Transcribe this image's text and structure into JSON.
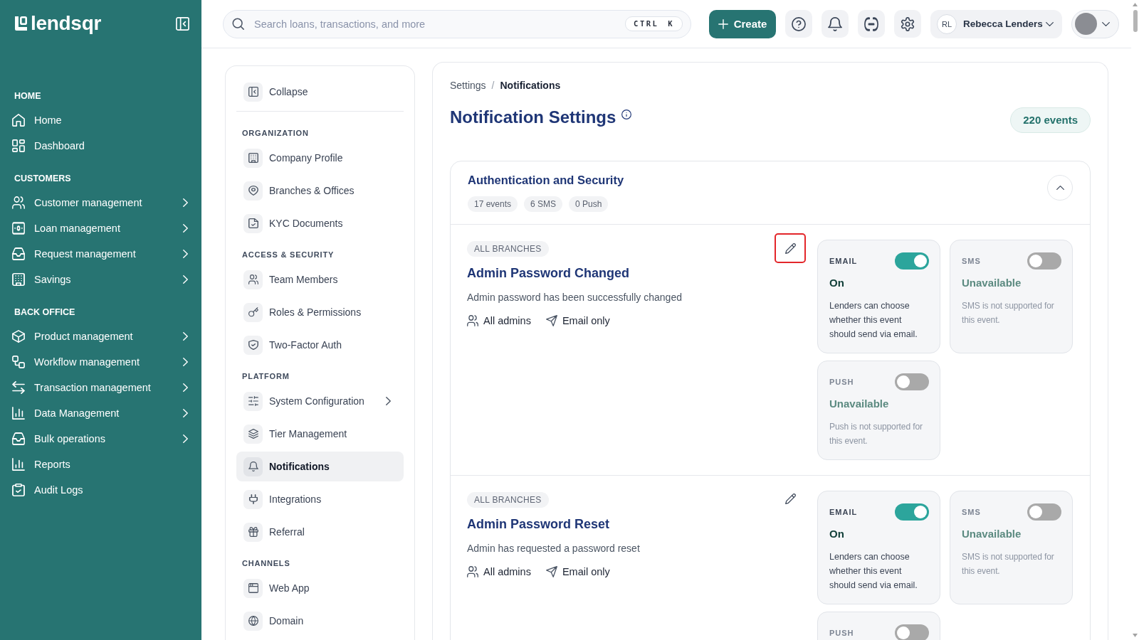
{
  "sidebar": {
    "logo": "lendsqr",
    "sections": [
      {
        "title": "HOME",
        "items": [
          {
            "label": "Home",
            "expandable": false,
            "selected": false
          },
          {
            "label": "Dashboard",
            "expandable": false,
            "selected": false
          }
        ]
      },
      {
        "title": "CUSTOMERS",
        "items": [
          {
            "label": "Customer management",
            "expandable": true,
            "selected": false
          },
          {
            "label": "Loan management",
            "expandable": true,
            "selected": false
          },
          {
            "label": "Request management",
            "expandable": true,
            "selected": false
          },
          {
            "label": "Savings",
            "expandable": true,
            "selected": false
          }
        ]
      },
      {
        "title": "BACK OFFICE",
        "items": [
          {
            "label": "Product management",
            "expandable": true,
            "selected": false
          },
          {
            "label": "Workflow management",
            "expandable": true,
            "selected": false
          },
          {
            "label": "Transaction management",
            "expandable": true,
            "selected": false
          },
          {
            "label": "Data Management",
            "expandable": true,
            "selected": false
          },
          {
            "label": "Bulk operations",
            "expandable": true,
            "selected": false
          },
          {
            "label": "Reports",
            "expandable": false,
            "selected": false
          },
          {
            "label": "Audit Logs",
            "expandable": false,
            "selected": false
          }
        ]
      }
    ]
  },
  "topbar": {
    "search": {
      "placeholder": "Search loans, transactions, and more",
      "shortcut": "CTRL K"
    },
    "create_button": "Create",
    "user": {
      "initials": "RL",
      "name": "Rebecca Lenders"
    }
  },
  "settings_nav": {
    "collapse": "Collapse",
    "sections": [
      {
        "title": "ORGANIZATION",
        "items": [
          {
            "label": "Company Profile",
            "expandable": false,
            "selected": false
          },
          {
            "label": "Branches & Offices",
            "expandable": false,
            "selected": false
          },
          {
            "label": "KYC Documents",
            "expandable": false,
            "selected": false
          }
        ]
      },
      {
        "title": "ACCESS & SECURITY",
        "items": [
          {
            "label": "Team Members",
            "expandable": false,
            "selected": false
          },
          {
            "label": "Roles & Permissions",
            "expandable": false,
            "selected": false
          },
          {
            "label": "Two-Factor Auth",
            "expandable": false,
            "selected": false
          }
        ]
      },
      {
        "title": "PLATFORM",
        "items": [
          {
            "label": "System Configuration",
            "expandable": true,
            "selected": false
          },
          {
            "label": "Tier Management",
            "expandable": false,
            "selected": false
          },
          {
            "label": "Notifications",
            "expandable": false,
            "selected": true
          },
          {
            "label": "Integrations",
            "expandable": false,
            "selected": false
          },
          {
            "label": "Referral",
            "expandable": false,
            "selected": false
          }
        ]
      },
      {
        "title": "CHANNELS",
        "items": [
          {
            "label": "Web App",
            "expandable": false,
            "selected": false
          },
          {
            "label": "Domain",
            "expandable": false,
            "selected": false
          }
        ]
      }
    ]
  },
  "page": {
    "breadcrumb": {
      "separator": "/",
      "items": [
        {
          "label": "Settings",
          "current": false
        },
        {
          "label": "Notifications",
          "current": true
        }
      ]
    },
    "title": "Notification Settings",
    "event_count": "220 events"
  },
  "groups": [
    {
      "title": "Authentication and Security",
      "counts": [
        "17 events",
        "6 SMS",
        "0 Push"
      ],
      "expanded": true,
      "events": [
        {
          "scope": "ALL BRANCHES",
          "title": "Admin Password Changed",
          "description": "Admin password has been successfully changed",
          "audience": "All admins",
          "delivery": "Email only",
          "highlighted": true,
          "channels": [
            {
              "label": "EMAIL",
              "on": true,
              "available": true,
              "status": "On",
              "note": "Lenders can choose whether this event should send via email."
            },
            {
              "label": "SMS",
              "on": false,
              "available": false,
              "status": "Unavailable",
              "note": "SMS is not supported for this event."
            },
            {
              "label": "PUSH",
              "on": false,
              "available": false,
              "status": "Unavailable",
              "note": "Push is not supported for this event."
            }
          ]
        },
        {
          "scope": "ALL BRANCHES",
          "title": "Admin Password Reset",
          "description": "Admin has requested a password reset",
          "audience": "All admins",
          "delivery": "Email only",
          "highlighted": false,
          "channels": [
            {
              "label": "EMAIL",
              "on": true,
              "available": true,
              "status": "On",
              "note": "Lenders can choose whether this event should send via email."
            },
            {
              "label": "SMS",
              "on": false,
              "available": false,
              "status": "Unavailable",
              "note": "SMS is not supported for this event."
            },
            {
              "label": "PUSH",
              "on": false,
              "available": false
            }
          ]
        }
      ]
    }
  ]
}
